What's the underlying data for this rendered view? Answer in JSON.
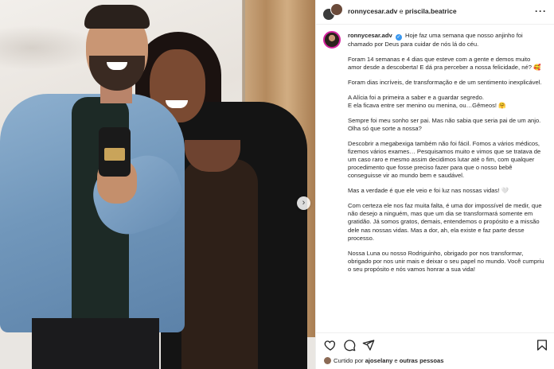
{
  "post": {
    "header": {
      "user1": "ronnycesar.adv",
      "joiner": " e ",
      "user2": "priscila.beatrice",
      "more_icon": "more-horizontal-icon"
    },
    "caption": {
      "username": "ronnycesar.adv",
      "verified_icon": "verified-badge-icon",
      "paragraphs": [
        "Hoje faz uma semana que nosso anjinho foi chamado por Deus para cuidar de nós lá do céu.",
        "Foram 14 semanas e 4 dias que esteve com a gente e demos muito amor desde a descoberta! E dá pra perceber a nossa felicidade, né? 🥰",
        "Foram dias incríveis, de transformação e de um sentimento inexplicável.",
        "A Alícia foi a primeira a saber e a guardar segredo.\nE ela ficava entre ser menino ou menina, ou…Gêmeos! 🤗",
        "Sempre foi meu sonho ser pai. Mas não sabia que seria pai de um anjo. Olha só que sorte a nossa?",
        "Descobrir a megabexiga também não foi fácil. Fomos a vários médicos, fizemos vários exames… Pesquisamos muito e vimos que se tratava de um caso raro e mesmo assim decidimos lutar até o fim, com qualquer procedimento que fosse preciso fazer para que o nosso bebê conseguisse vir ao mundo bem e saudável.",
        "Mas a verdade é que ele veio e foi luz nas nossas vidas! 🤍",
        "Com certeza ele nos faz muita falta, é uma dor impossível de medir, que não desejo a ninguém, mas que um dia se transformará somente em gratidão. Já somos gratos, demais, entendemos o propósito e a missão dele nas nossas vidas. Mas a dor, ah, ela existe e faz parte desse processo.",
        "Nossa Luna ou nosso Rodriguinho, obrigado por nos transformar, obrigado por nos unir mais e deixar o seu papel no mundo. Você cumpriu o seu propósito e nós vamos honrar a sua vida!"
      ]
    },
    "actions": {
      "like_icon": "heart-icon",
      "comment_icon": "comment-icon",
      "share_icon": "share-icon",
      "save_icon": "bookmark-icon"
    },
    "likes": {
      "prefix": "Curtido por ",
      "user": "ajoselany",
      "suffix": " e ",
      "others": "outras pessoas"
    },
    "carousel": {
      "next_icon": "chevron-right-icon",
      "next_glyph": "›"
    }
  }
}
